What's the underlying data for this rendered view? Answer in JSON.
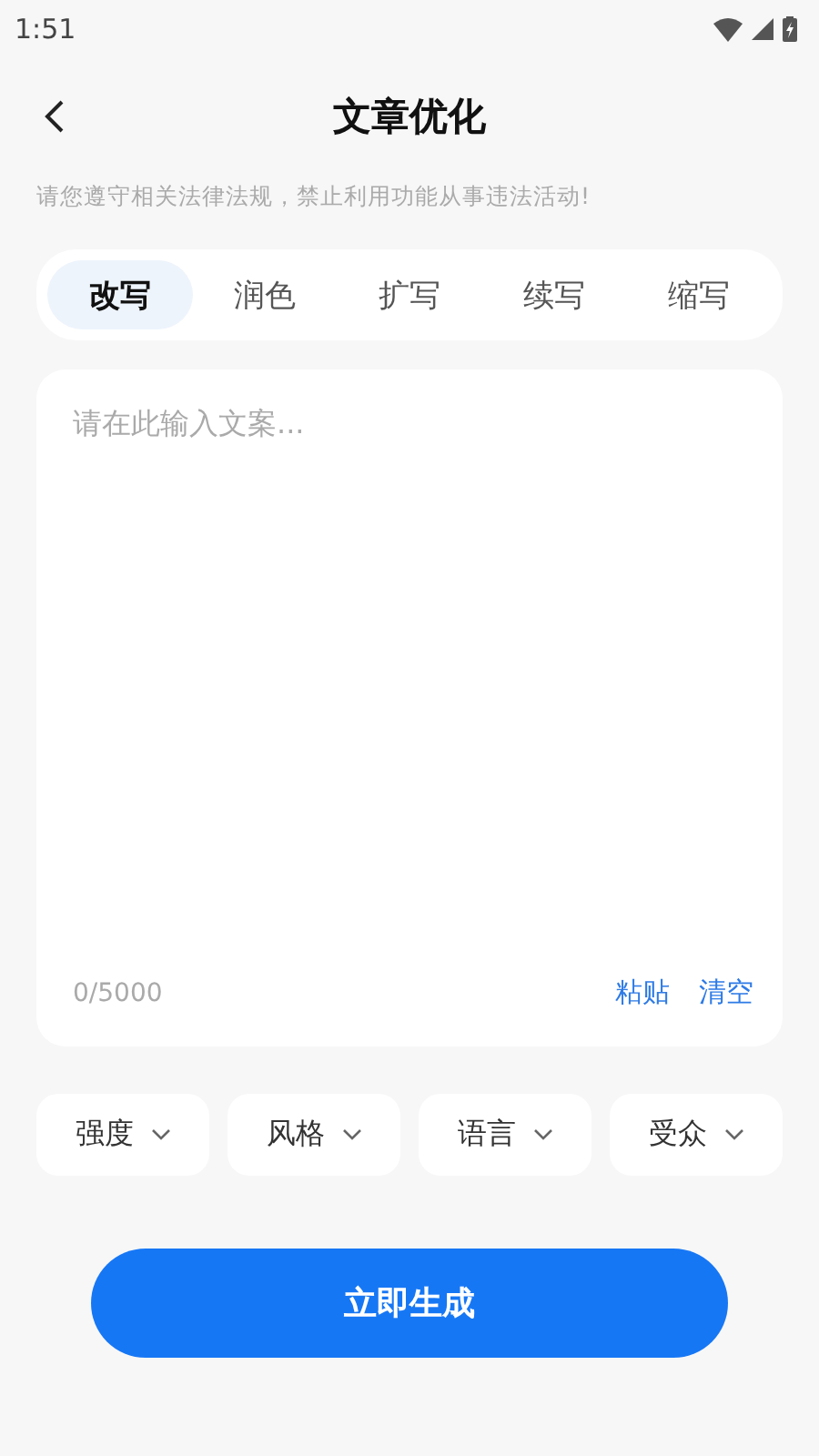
{
  "status_bar": {
    "time": "1:51"
  },
  "header": {
    "title": "文章优化"
  },
  "notice": "请您遵守相关法律法规，禁止利用功能从事违法活动!",
  "tabs": [
    {
      "label": "改写",
      "selected": true
    },
    {
      "label": "润色",
      "selected": false
    },
    {
      "label": "扩写",
      "selected": false
    },
    {
      "label": "续写",
      "selected": false
    },
    {
      "label": "缩写",
      "selected": false
    }
  ],
  "editor": {
    "placeholder": "请在此输入文案...",
    "counter": "0/5000",
    "actions": [
      "粘贴",
      "清空"
    ]
  },
  "options": [
    "强度",
    "风格",
    "语言",
    "受众"
  ],
  "submit": "立即生成"
}
